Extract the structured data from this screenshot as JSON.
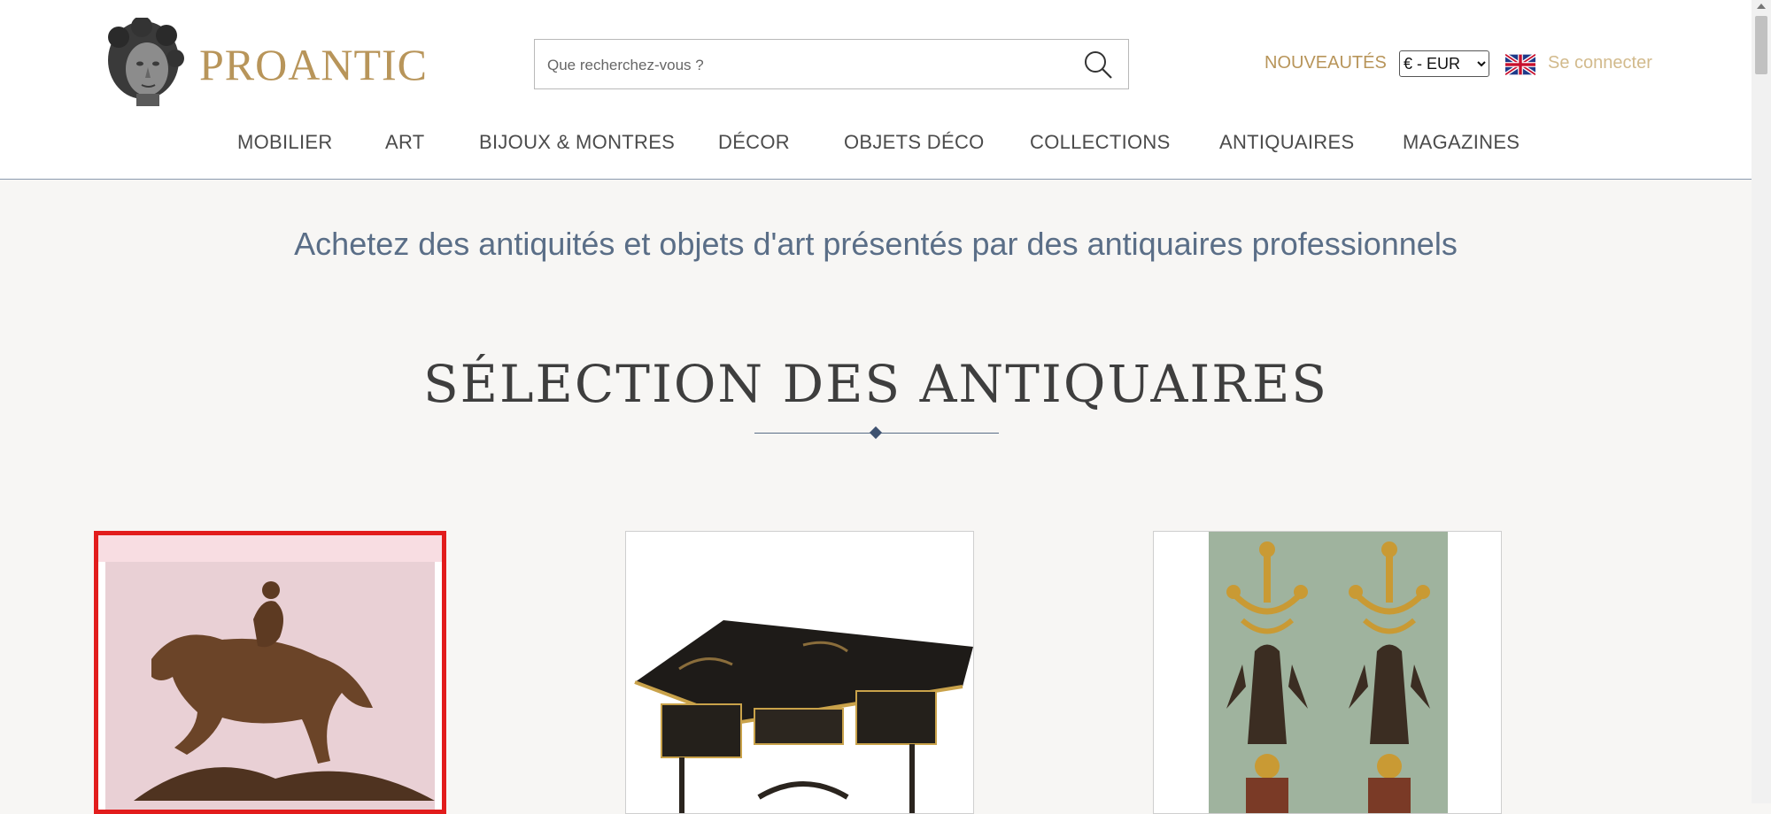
{
  "header": {
    "logo_text": "PROANTIC",
    "logo_icon": "sculpted-head-icon",
    "search_placeholder": "Que recherchez-vous ?",
    "search_icon": "search-icon",
    "nouveautes": "NOUVEAUTÉS",
    "currency": {
      "selected": "€ - EUR",
      "options": [
        "€ - EUR"
      ]
    },
    "flag_icon": "uk-flag-icon",
    "login": "Se connecter"
  },
  "nav": {
    "items": [
      "MOBILIER",
      "ART",
      "BIJOUX & MONTRES",
      "DÉCOR",
      "OBJETS DÉCO",
      "COLLECTIONS",
      "ANTIQUAIRES",
      "MAGAZINES"
    ]
  },
  "main": {
    "tagline": "Achetez des antiquités et objets d'art présentés par des antiquaires professionnels",
    "section_title": "SÉLECTION DES ANTIQUAIRES"
  },
  "cards": [
    {
      "subject": "bronze-horse-rider",
      "selected": true
    },
    {
      "subject": "black-lacquer-desk",
      "selected": false
    },
    {
      "subject": "gilt-bronze-candelabra-pair",
      "selected": false
    }
  ],
  "colors": {
    "gold": "#b8955a",
    "accent_blue": "#5a6e87",
    "selection": "#e21c1c"
  }
}
